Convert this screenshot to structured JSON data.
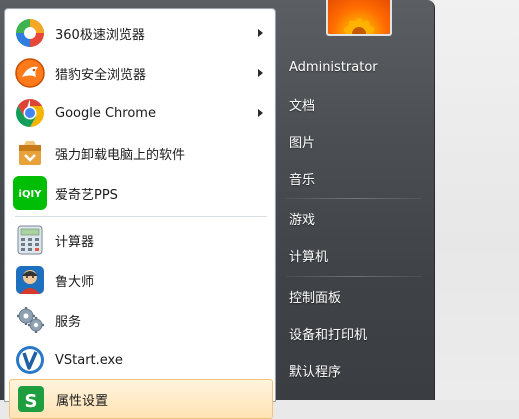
{
  "left_programs": [
    {
      "label": "360极速浏览器",
      "icon": "360-browser-icon",
      "has_submenu": true
    },
    {
      "label": "猎豹安全浏览器",
      "icon": "cheetah-browser-icon",
      "has_submenu": true
    },
    {
      "label": "Google Chrome",
      "icon": "chrome-icon",
      "has_submenu": true
    },
    {
      "label": "强力卸载电脑上的软件",
      "icon": "uninstall-icon",
      "has_submenu": false
    },
    {
      "label": "爱奇艺PPS",
      "icon": "iqiyi-icon",
      "has_submenu": false
    },
    {
      "label": "计算器",
      "icon": "calculator-icon",
      "has_submenu": false
    },
    {
      "label": "鲁大师",
      "icon": "ludashi-icon",
      "has_submenu": false
    },
    {
      "label": "服务",
      "icon": "services-icon",
      "has_submenu": false
    },
    {
      "label": "VStart.exe",
      "icon": "vstart-icon",
      "has_submenu": false
    },
    {
      "label": "属性设置",
      "icon": "settings-icon",
      "has_submenu": false
    }
  ],
  "right_items": [
    {
      "label": "Administrator"
    },
    {
      "label": "文档"
    },
    {
      "label": "图片"
    },
    {
      "label": "音乐"
    },
    {
      "label": "游戏"
    },
    {
      "label": "计算机"
    },
    {
      "label": "控制面板"
    },
    {
      "label": "设备和打印机"
    },
    {
      "label": "默认程序"
    }
  ],
  "colors": {
    "highlight": "#ffe3b3",
    "frame": "#4b4f53",
    "panel": "#ffffff"
  }
}
